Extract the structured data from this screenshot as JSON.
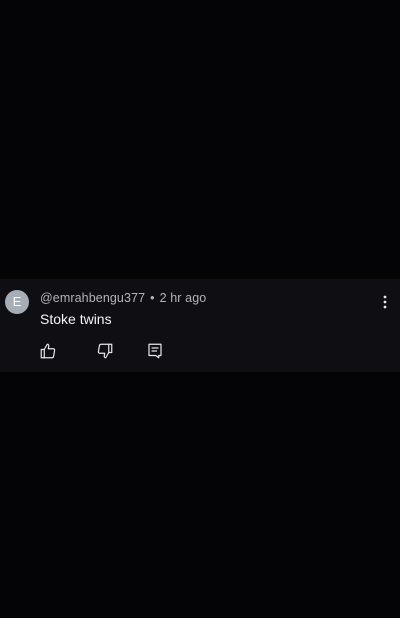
{
  "comment": {
    "avatar_letter": "E",
    "avatar_color": "#a6adb6",
    "username": "@emrahbengu377",
    "separator": "•",
    "time": "2 hr ago",
    "text": "Stoke twins"
  },
  "actions": {
    "more_icon": "more-vertical-icon",
    "like_icon": "thumbs-up-icon",
    "dislike_icon": "thumbs-down-icon",
    "reply_icon": "reply-icon"
  },
  "colors": {
    "background": "#040407",
    "card_background": "#0f0e12",
    "meta_text": "#b4b4b8",
    "body_text": "#f4f4f6"
  }
}
